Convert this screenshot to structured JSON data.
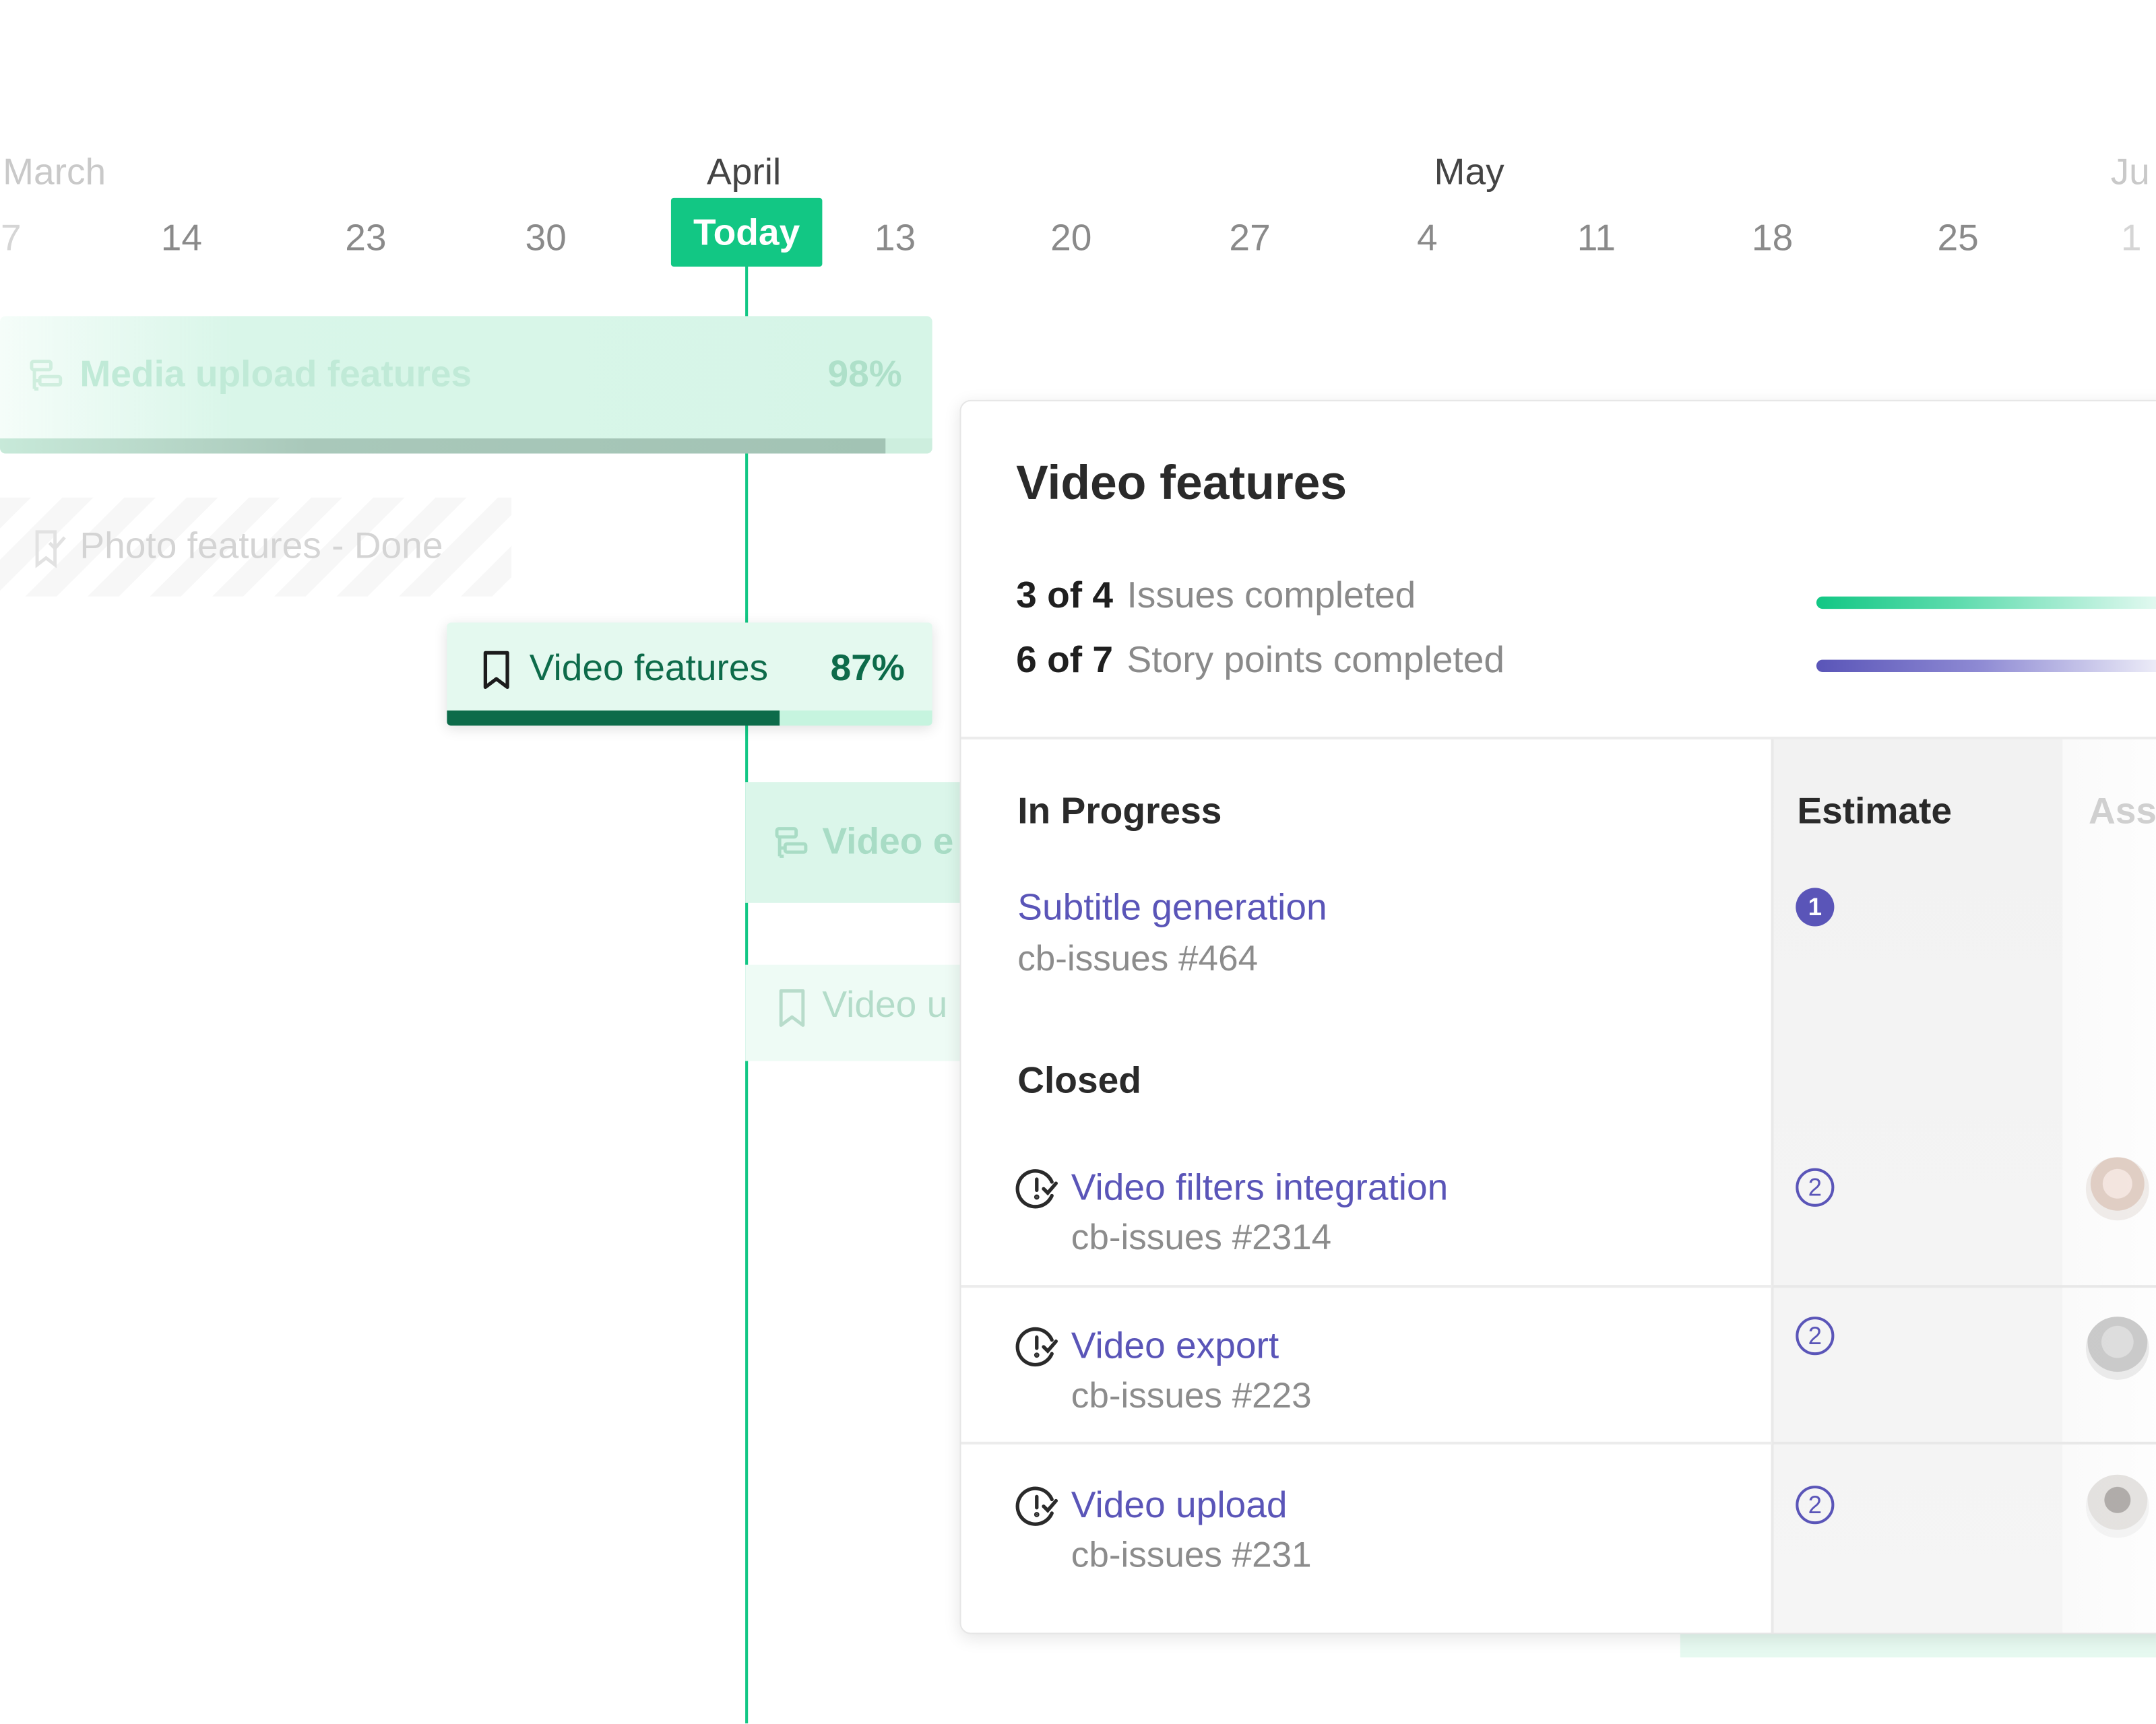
{
  "timeline": {
    "months": [
      {
        "label": "March",
        "faded": true
      },
      {
        "label": "April",
        "faded": false
      },
      {
        "label": "May",
        "faded": false
      },
      {
        "label": "Ju",
        "faded": true
      }
    ],
    "days": [
      "7",
      "14",
      "23",
      "30",
      "13",
      "20",
      "27",
      "4",
      "11",
      "18",
      "25",
      "1"
    ],
    "today_label": "Today"
  },
  "gantt": {
    "media_upload": {
      "label": "Media upload features",
      "percent": "98%",
      "progress": 0.95
    },
    "photo": {
      "label": "Photo features - Done"
    },
    "video": {
      "label": "Video features",
      "percent": "87%",
      "progress": 0.686
    },
    "video_e": {
      "label": "Video e"
    },
    "video_u": {
      "label": "Video u"
    }
  },
  "panel": {
    "title": "Video features",
    "stats": [
      {
        "count": "3 of 4",
        "label": "Issues completed"
      },
      {
        "count": "6 of 7",
        "label": "Story points completed"
      }
    ],
    "columns": {
      "estimate": "Estimate",
      "assignee": "Ass"
    },
    "sections": {
      "in_progress": {
        "title": "In Progress",
        "issues": [
          {
            "title": "Subtitle generation",
            "id": "cb-issues #464",
            "estimate": "1"
          }
        ]
      },
      "closed": {
        "title": "Closed",
        "issues": [
          {
            "title": "Video filters integration",
            "id": "cb-issues #2314",
            "estimate": "2"
          },
          {
            "title": "Video export",
            "id": "cb-issues #223",
            "estimate": "2"
          },
          {
            "title": "Video upload",
            "id": "cb-issues #231",
            "estimate": "2"
          }
        ]
      }
    }
  },
  "colors": {
    "accent_green": "#12c784",
    "dark_green": "#0d6b4a",
    "link_purple": "#5a55b8"
  }
}
